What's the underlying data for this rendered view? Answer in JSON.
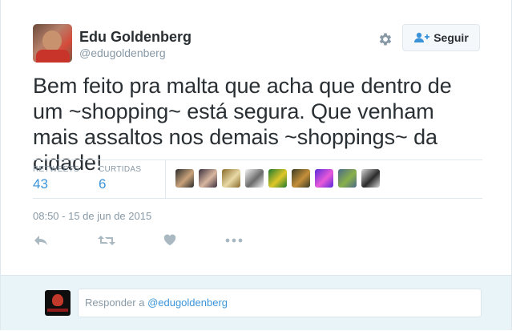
{
  "author": {
    "name": "Edu Goldenberg",
    "handle": "@edugoldenberg"
  },
  "follow_button": {
    "label": "Seguir",
    "icon": "add-user-icon"
  },
  "settings_icon": "gear-icon",
  "tweet": {
    "text": "Bem feito pra malta que acha que dentro de um ~shopping~ está segura. Que venham mais assaltos nos demais ~shoppings~ da cidade!"
  },
  "stats": {
    "retweets_label": "RETWEETS",
    "retweets_value": "43",
    "likes_label": "CURTIDAS",
    "likes_value": "6"
  },
  "liker_avatars": [
    {
      "color_a": "#2b2b2b",
      "color_b": "#c9a27a"
    },
    {
      "color_a": "#3a2e3c",
      "color_b": "#d9b7a0"
    },
    {
      "color_a": "#8a6a2a",
      "color_b": "#e8d9a5"
    },
    {
      "color_a": "#f4f4f4",
      "color_b": "#6b6b6b"
    },
    {
      "color_a": "#1f7a2e",
      "color_b": "#e0c72a"
    },
    {
      "color_a": "#3b3b22",
      "color_b": "#c48f3a"
    },
    {
      "color_a": "#5a2ad9",
      "color_b": "#e85ad9"
    },
    {
      "color_a": "#4a6a8a",
      "color_b": "#8ab04a"
    },
    {
      "color_a": "#d8d8d8",
      "color_b": "#2a2a2a"
    }
  ],
  "timestamp": "08:50 - 15 de jun de 2015",
  "actions": [
    "reply-icon",
    "retweet-icon",
    "heart-icon",
    "more-icon"
  ],
  "reply": {
    "prefix": "Responder a ",
    "mention": "@edugoldenberg"
  },
  "colors": {
    "link": "#3b94d9",
    "muted": "#8899a6",
    "reply_bar": "#e8f4f7"
  }
}
